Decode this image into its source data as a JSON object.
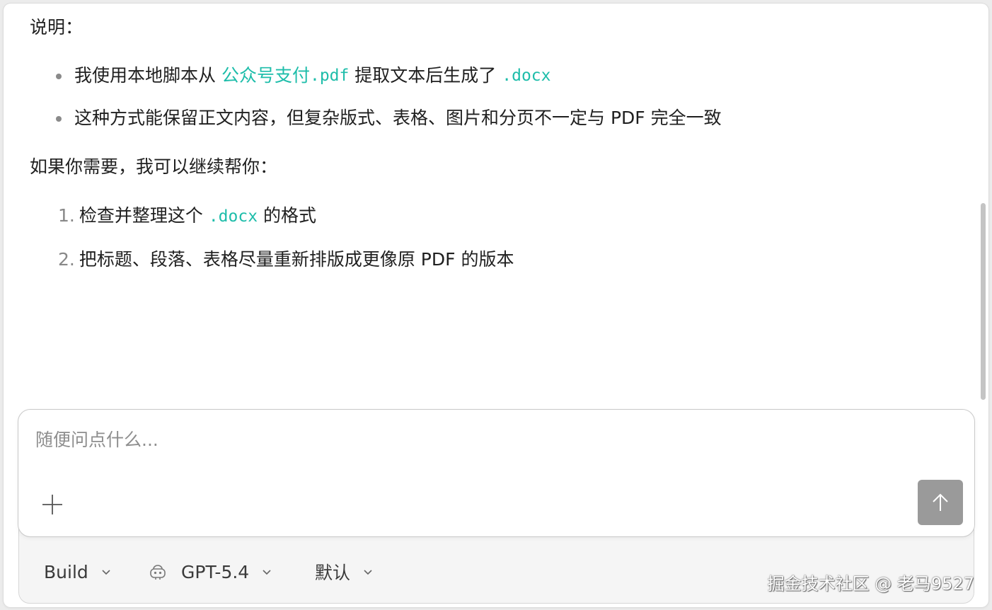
{
  "message": {
    "intro": "说明：",
    "bullets": [
      {
        "prefix": "我使用本地脚本从 ",
        "filename": "公众号支付",
        "ext": ".pdf",
        "middle": " 提取文本后生成了 ",
        "code": ".docx"
      },
      {
        "text": "这种方式能保留正文内容，但复杂版式、表格、图片和分页不一定与 PDF 完全一致"
      }
    ],
    "offer": "如果你需要，我可以继续帮你：",
    "options": [
      {
        "num": "1.",
        "prefix": "检查并整理这个 ",
        "code": ".docx",
        "suffix": " 的格式"
      },
      {
        "num": "2.",
        "text": "把标题、段落、表格尽量重新排版成更像原 PDF 的版本"
      }
    ]
  },
  "composer": {
    "placeholder": "随便问点什么..."
  },
  "toolbar": {
    "mode": "Build",
    "model": "GPT-5.4",
    "preset": "默认"
  },
  "watermark": "掘金技术社区 @ 老马9527",
  "colors": {
    "accent": "#1ebdaa",
    "send_button": "#9a9a9a"
  },
  "icons": [
    "plus-icon",
    "arrow-up-icon",
    "robot-icon",
    "chevron-down-icon"
  ]
}
